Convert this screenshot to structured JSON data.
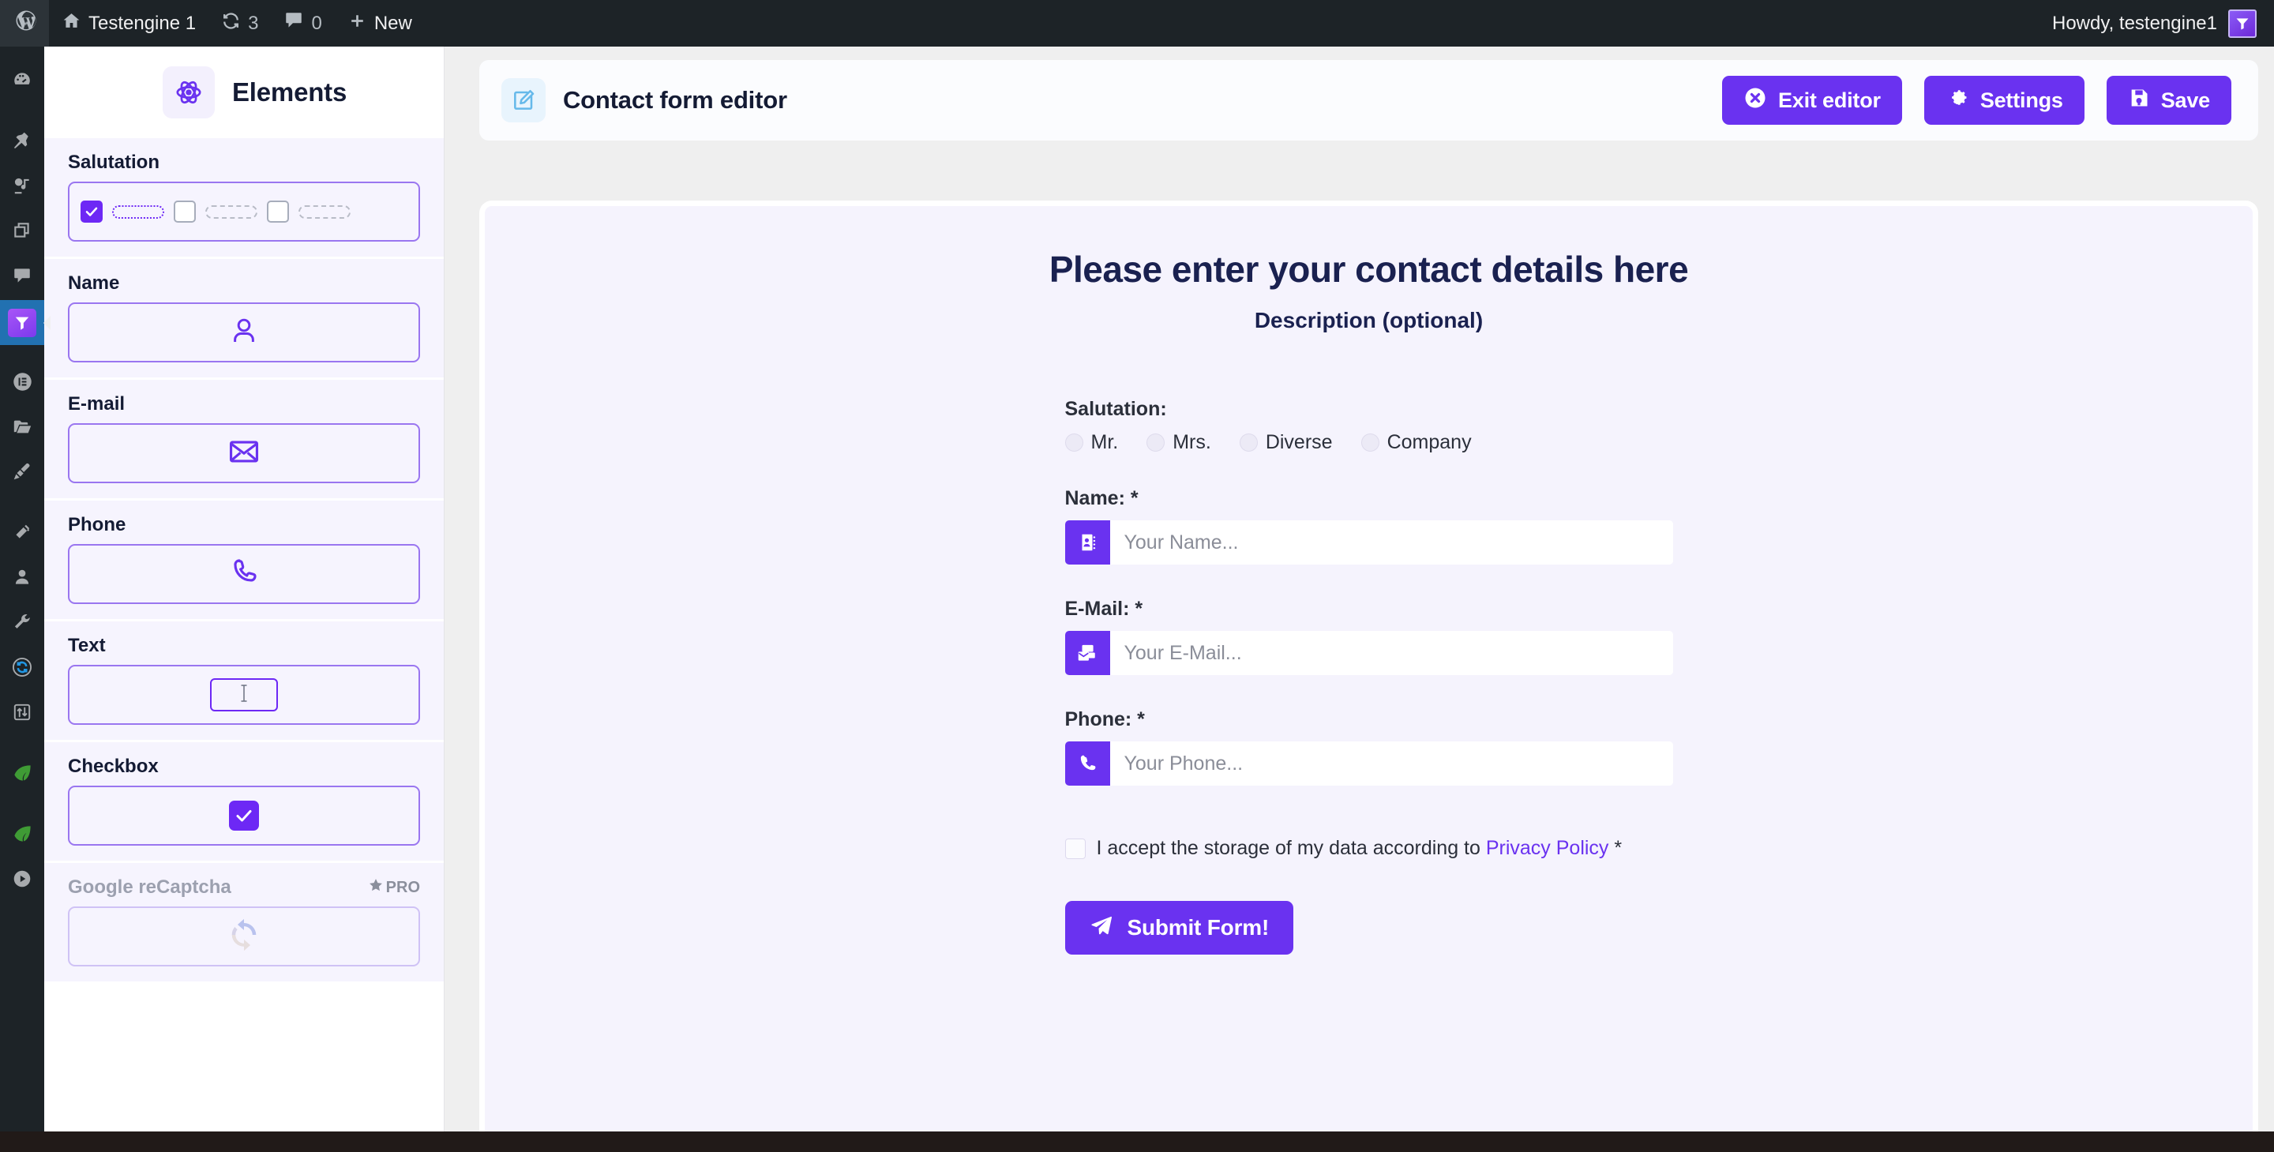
{
  "adminbar": {
    "site_name": "Testengine 1",
    "updates_count": "3",
    "comments_count": "0",
    "new_label": "New",
    "howdy": "Howdy, testengine1",
    "icons": {
      "wp_logo": "wordpress-logo-icon",
      "home": "home-icon",
      "updates": "updates-icon",
      "comments": "comment-bubble-icon",
      "new": "plus-icon",
      "avatar": "user-avatar-icon"
    }
  },
  "adminmenu": {
    "items": [
      {
        "name": "dashboard",
        "icon": "dashboard-gauge-icon",
        "current": false
      },
      {
        "name": "posts",
        "icon": "pin-icon",
        "current": false
      },
      {
        "name": "media",
        "icon": "media-photo-music-icon",
        "current": false
      },
      {
        "name": "pages",
        "icon": "pages-stack-icon",
        "current": false
      },
      {
        "name": "comments",
        "icon": "comment-bubble-icon",
        "current": false
      },
      {
        "name": "forms",
        "icon": "funnel-icon",
        "current": true
      },
      {
        "name": "elementor",
        "icon": "elementor-circle-icon",
        "current": false
      },
      {
        "name": "media-folders",
        "icon": "folder-open-icon",
        "current": false
      },
      {
        "name": "appearance",
        "icon": "paint-brush-icon",
        "current": false
      },
      {
        "name": "plugins",
        "icon": "plug-icon",
        "current": false
      },
      {
        "name": "users",
        "icon": "user-icon",
        "current": false
      },
      {
        "name": "tools",
        "icon": "wrench-icon",
        "current": false
      },
      {
        "name": "updates",
        "icon": "sync-circle-icon",
        "current": false
      },
      {
        "name": "settings",
        "icon": "sliders-icon",
        "current": false
      },
      {
        "name": "leaf-plugin-1",
        "icon": "leaf-icon",
        "current": false
      },
      {
        "name": "leaf-plugin-2",
        "icon": "leaf-icon",
        "current": false
      },
      {
        "name": "video-plugin",
        "icon": "play-circle-icon",
        "current": false
      }
    ]
  },
  "elements_panel": {
    "title": "Elements",
    "title_icon": "atom-icon",
    "items": [
      {
        "label": "Salutation",
        "preview": "salutation",
        "icon": "checkbox-group-icon",
        "disabled": false
      },
      {
        "label": "Name",
        "preview": "icon",
        "icon": "user-outline-icon",
        "disabled": false
      },
      {
        "label": "E-mail",
        "preview": "icon",
        "icon": "envelope-outline-icon",
        "disabled": false
      },
      {
        "label": "Phone",
        "preview": "icon",
        "icon": "phone-outline-icon",
        "disabled": false
      },
      {
        "label": "Text",
        "preview": "text",
        "icon": "text-cursor-icon",
        "disabled": false
      },
      {
        "label": "Checkbox",
        "preview": "checkbox",
        "icon": "checkbox-checked-icon",
        "disabled": false
      },
      {
        "label": "Google reCaptcha",
        "preview": "recaptcha",
        "icon": "recaptcha-icon",
        "disabled": true,
        "badge": "PRO",
        "badge_icon": "star-icon"
      }
    ]
  },
  "editor_header": {
    "title": "Contact form editor",
    "title_icon": "edit-pencil-square-icon",
    "buttons": [
      {
        "label": "Exit editor",
        "icon": "close-circle-icon",
        "name": "exit-editor-button"
      },
      {
        "label": "Settings",
        "icon": "gear-icon",
        "name": "settings-button"
      },
      {
        "label": "Save",
        "icon": "floppy-disk-icon",
        "name": "save-button"
      }
    ]
  },
  "form_preview": {
    "title": "Please enter your contact details here",
    "description": "Description (optional)",
    "salutation": {
      "label": "Salutation:",
      "options": [
        "Mr.",
        "Mrs.",
        "Diverse",
        "Company"
      ]
    },
    "fields": [
      {
        "label": "Name: *",
        "placeholder": "Your Name...",
        "icon": "address-book-icon",
        "name": "name-field"
      },
      {
        "label": "E-Mail: *",
        "placeholder": "Your E-Mail...",
        "icon": "mail-stack-icon",
        "name": "email-field"
      },
      {
        "label": "Phone: *",
        "placeholder": "Your Phone...",
        "icon": "phone-handset-icon",
        "name": "phone-field"
      }
    ],
    "consent": {
      "text_before": "I accept the storage of my data according to ",
      "link": "Privacy Policy",
      "text_after": " *"
    },
    "submit": {
      "label": "Submit Form!",
      "icon": "paper-plane-icon"
    }
  },
  "colors": {
    "accent": "#6a32f0",
    "admin_bar": "#1d2327",
    "panel_bg": "#f5f3fd",
    "current_menu": "#2271b1"
  }
}
